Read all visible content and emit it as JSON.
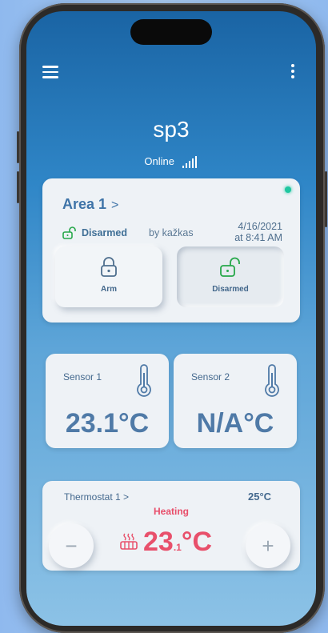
{
  "header": {
    "site_name": "sp3",
    "connection_status": "Online",
    "menu_icon": "hamburger-menu-icon",
    "more_icon": "kebab-menu-icon"
  },
  "area": {
    "title": "Area 1",
    "chevron": ">",
    "status_label": "Disarmed",
    "by_user": "by kažkas",
    "date": "4/16/2021",
    "time": "at 8:41 AM",
    "online": true,
    "arm_button_label": "Arm",
    "disarm_button_label": "Disarmed",
    "selected_state": "disarmed"
  },
  "sensors": [
    {
      "name": "Sensor 1",
      "value": "23.1°C",
      "icon": "thermometer-icon"
    },
    {
      "name": "Sensor 2",
      "value": "N/A°C",
      "icon": "thermometer-icon"
    }
  ],
  "thermostat": {
    "name": "Thermostat 1",
    "chevron": ">",
    "setpoint": "25°C",
    "mode": "Heating",
    "temp_integer": "23",
    "temp_decimal": ".1",
    "temp_unit": "°C",
    "minus_label": "−",
    "plus_label": "+"
  },
  "colors": {
    "accent_green": "#1ec7a0",
    "lock_green": "#27a84a",
    "heating_red": "#e8506b",
    "card_text_blue": "#3f74a8"
  }
}
